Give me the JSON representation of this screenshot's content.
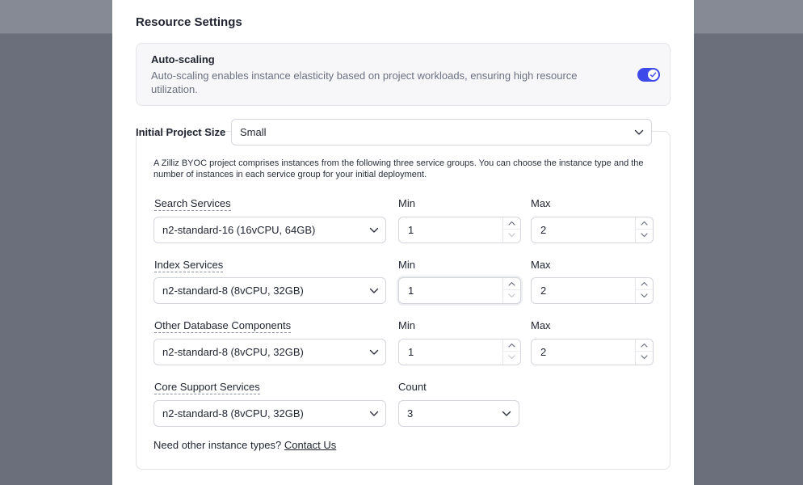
{
  "section": {
    "title": "Resource Settings"
  },
  "autoscaling": {
    "title": "Auto-scaling",
    "description": "Auto-scaling enables instance elasticity based on project workloads, ensuring high resource utilization.",
    "enabled": true,
    "accent_color": "#3d49e8"
  },
  "project_size": {
    "label": "Initial Project Size",
    "value": "Small"
  },
  "services": {
    "intro": "A Zilliz BYOC project comprises instances from the following three service groups. You can choose the instance type and the number of instances in each service group for your initial deployment.",
    "min_label": "Min",
    "max_label": "Max",
    "count_label": "Count",
    "groups": [
      {
        "name": "Search Services",
        "instance": "n2-standard-16 (16vCPU, 64GB)",
        "min": "1",
        "max": "2"
      },
      {
        "name": "Index Services",
        "instance": "n2-standard-8 (8vCPU, 32GB)",
        "min": "1",
        "max": "2"
      },
      {
        "name": "Other Database Components",
        "instance": "n2-standard-8 (8vCPU, 32GB)",
        "min": "1",
        "max": "2"
      },
      {
        "name": "Core Support Services",
        "instance": "n2-standard-8 (8vCPU, 32GB)",
        "count": "3"
      }
    ],
    "footer_text": "Need other instance types?",
    "footer_link": "Contact Us"
  },
  "icons": {
    "chevron": "chevron-down-icon",
    "spin_up": "chevron-up-icon",
    "spin_down": "chevron-down-icon",
    "check": "check-icon"
  }
}
